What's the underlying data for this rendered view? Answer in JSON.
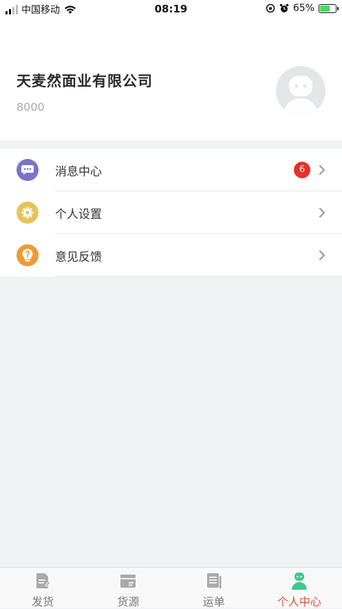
{
  "status_bar": {
    "carrier": "中国移动",
    "time": "08:19",
    "battery": "65%",
    "battery_level": 0.65
  },
  "profile": {
    "company_name": "天麦然面业有限公司",
    "user_id": "8000"
  },
  "menu": {
    "items": [
      {
        "label": "消息中心",
        "badge": "6",
        "icon": "message-icon",
        "color": "#7b73c9"
      },
      {
        "label": "个人设置",
        "icon": "gear-icon",
        "color": "#e7c35a"
      },
      {
        "label": "意见反馈",
        "icon": "question-bulb-icon",
        "color": "#ee9a35"
      }
    ]
  },
  "tabbar": {
    "tabs": [
      {
        "label": "发货",
        "icon": "document-icon"
      },
      {
        "label": "货源",
        "icon": "box-icon"
      },
      {
        "label": "运单",
        "icon": "list-icon"
      },
      {
        "label": "个人中心",
        "icon": "person-icon",
        "active": true
      }
    ],
    "active_color": "#e2513b",
    "active_icon_color": "#3fc78d"
  }
}
